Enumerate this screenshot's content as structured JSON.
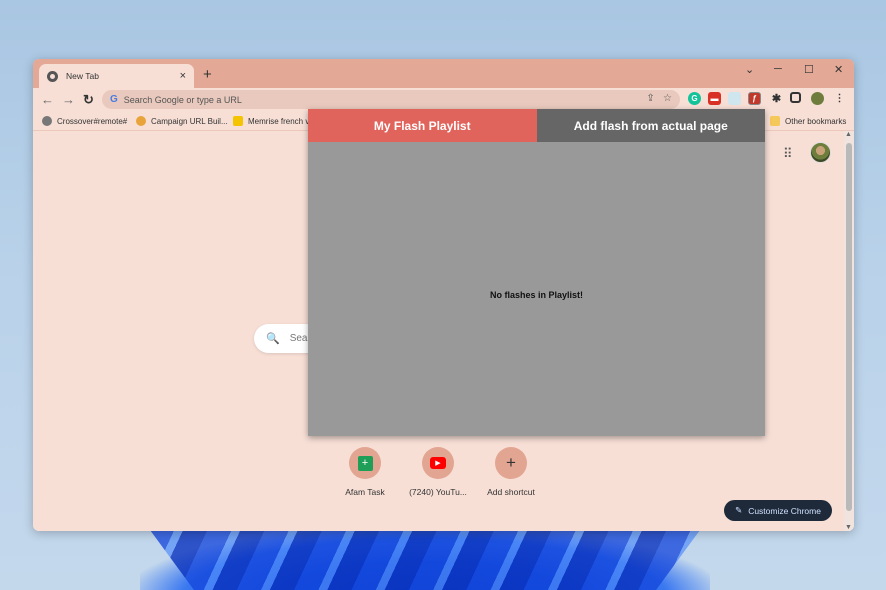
{
  "browser": {
    "tab_title": "New Tab",
    "tab_close": "×",
    "new_tab": "+",
    "omnibox_placeholder": "Search Google or type a URL",
    "bookmarks": [
      {
        "label": "Crossover#remote#",
        "color": "#555555"
      },
      {
        "label": "Campaign URL Buil...",
        "color": "#e8a33b"
      },
      {
        "label": "Memrise french v",
        "color": "#f5c400"
      }
    ],
    "other_bookmarks": "Other bookmarks"
  },
  "window_controls": {
    "chevron": "⌄",
    "minimize": "─",
    "maximize": "☐",
    "close": "✕"
  },
  "page": {
    "search_placeholder": "Sear",
    "shortcuts": [
      {
        "label": "Afam Task",
        "icon": "sheets-icon",
        "glyph": "⊞",
        "color": "#1e9e57"
      },
      {
        "label": "(7240) YouTu...",
        "icon": "youtube-icon",
        "glyph": "▶",
        "color": "#ff0000"
      },
      {
        "label": "Add shortcut",
        "icon": "plus-icon",
        "glyph": "+",
        "color": "#333333"
      }
    ],
    "customize_label": "Customize Chrome"
  },
  "popup": {
    "tab_active": "My Flash Playlist",
    "tab_inactive": "Add flash from actual page",
    "empty_message": "No flashes in Playlist!"
  },
  "colors": {
    "accent": "#e0645c",
    "tab_inactive": "#666666",
    "popup_body": "#999999",
    "titlebar": "#e3a996",
    "page_bg": "#f7dfd6"
  }
}
